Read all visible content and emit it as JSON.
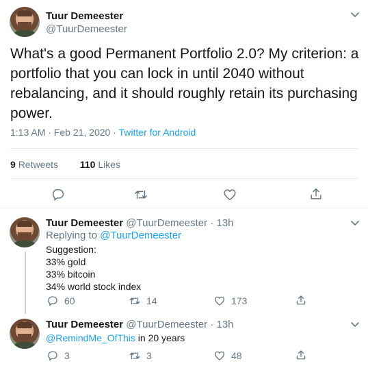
{
  "main_tweet": {
    "author_name": "Tuur Demeester",
    "author_handle": "@TuurDemeester",
    "text": "What's a good Permanent Portfolio 2.0?  My criterion: a portfolio that you can lock in until 2040 without rebalancing, and it should roughly retain its purchasing power.",
    "timestamp": "1:13 AM · Feb 21, 2020 · ",
    "source": "Twitter for Android",
    "retweets_count": "9",
    "retweets_label": "Retweets",
    "likes_count": "110",
    "likes_label": "Likes"
  },
  "replies": [
    {
      "author_name": "Tuur Demeester",
      "author_handle": "@TuurDemeester",
      "time": "13h",
      "replying_label": "Replying to ",
      "replying_to": "@TuurDemeester",
      "lines": [
        "Suggestion:",
        "33% gold",
        "33% bitcoin",
        "34% world stock index"
      ],
      "reply_count": "60",
      "retweet_count": "14",
      "like_count": "173"
    },
    {
      "author_name": "Tuur Demeester",
      "author_handle": "@TuurDemeester",
      "time": "13h",
      "mention": "@RemindMe_OfThis",
      "text_rest": " in 20 years",
      "reply_count": "3",
      "retweet_count": "3",
      "like_count": "48"
    }
  ],
  "icons": {
    "reply": "reply-icon",
    "retweet": "retweet-icon",
    "like": "heart-icon",
    "share": "share-icon",
    "more": "chevron-down-icon"
  },
  "colors": {
    "accent": "#1da1f2",
    "secondary_text": "#657786",
    "border": "#e6ecf0"
  }
}
